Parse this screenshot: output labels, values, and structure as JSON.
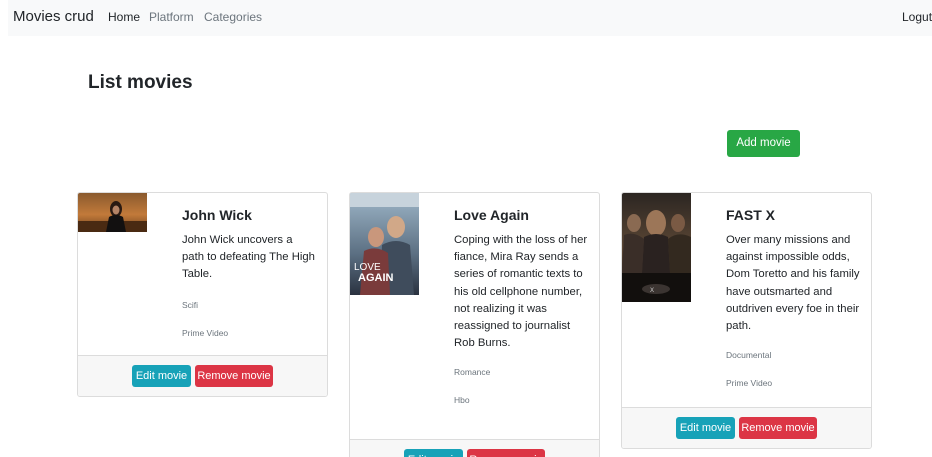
{
  "navbar": {
    "brand": "Movies crud",
    "links": [
      {
        "label": "Home",
        "active": true
      },
      {
        "label": "Platform",
        "active": false
      },
      {
        "label": "Categories",
        "active": false
      }
    ],
    "logout": "Logut"
  },
  "page": {
    "title": "List movies",
    "add_button": "Add movie"
  },
  "movies": [
    {
      "title": "John Wick",
      "description": "John Wick uncovers a path to defeating The High Table.",
      "category": "Scifi",
      "platform": "Prime Video",
      "poster_icon": "john-wick-poster",
      "edit_label": "Edit movie",
      "remove_label": "Remove movie"
    },
    {
      "title": "Love Again",
      "description": "Coping with the loss of her fiance, Mira Ray sends a series of romantic texts to his old cellphone number, not realizing it was reassigned to journalist Rob Burns.",
      "category": "Romance",
      "platform": "Hbo",
      "poster_icon": "love-again-poster",
      "poster_text_line1": "LOVE",
      "poster_text_line2": "AGAIN",
      "edit_label": "Edit movie",
      "remove_label": "Remove movie"
    },
    {
      "title": "FAST X",
      "description": "Over many missions and against impossible odds, Dom Toretto and his family have outsmarted and outdriven every foe in their path.",
      "category": "Documental",
      "platform": "Prime Video",
      "poster_icon": "fast-x-poster",
      "edit_label": "Edit movie",
      "remove_label": "Remove movie"
    }
  ],
  "colors": {
    "primary_action": "#28a745",
    "edit": "#17a2b8",
    "remove": "#dc3545",
    "navbar_bg": "#f8f9fa"
  }
}
